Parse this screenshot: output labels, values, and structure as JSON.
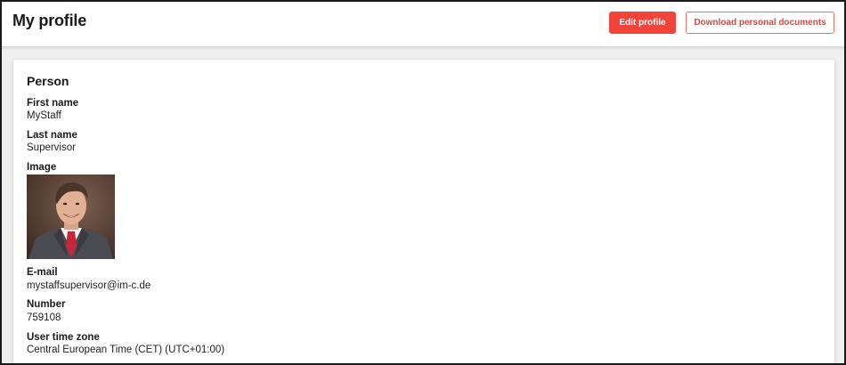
{
  "header": {
    "title": "My profile",
    "edit_button": "Edit profile",
    "download_button": "Download personal documents"
  },
  "person": {
    "section_title": "Person",
    "first_name": {
      "label": "First name",
      "value": "MyStaff"
    },
    "last_name": {
      "label": "Last name",
      "value": "Supervisor"
    },
    "image": {
      "label": "Image",
      "description": "Portrait photo of a smiling man in a suit and red tie"
    },
    "email": {
      "label": "E-mail",
      "value": "mystaffsupervisor@im-c.de"
    },
    "number": {
      "label": "Number",
      "value": "759108"
    },
    "time_zone": {
      "label": "User time zone",
      "value": "Central European Time (CET) (UTC+01:00)"
    }
  },
  "colors": {
    "accent": "#f2443b",
    "page_background": "#efefef"
  }
}
